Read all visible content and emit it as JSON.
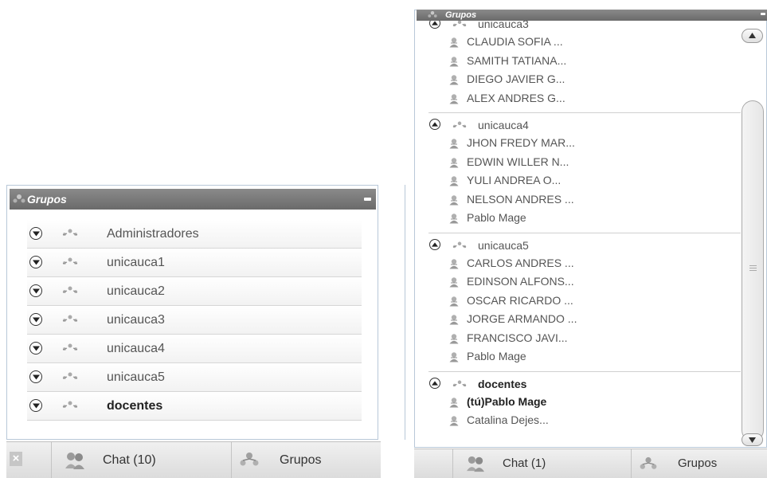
{
  "left_panel": {
    "title": "Grupos",
    "groups": [
      {
        "name": "Administradores",
        "bold": false
      },
      {
        "name": "unicauca1",
        "bold": false
      },
      {
        "name": "unicauca2",
        "bold": false
      },
      {
        "name": "unicauca3",
        "bold": false
      },
      {
        "name": "unicauca4",
        "bold": false
      },
      {
        "name": "unicauca5",
        "bold": false
      },
      {
        "name": "docentes",
        "bold": true
      }
    ],
    "tabs": {
      "chat_label": "Chat (10)",
      "groups_label": "Grupos"
    },
    "close_label": "×"
  },
  "right_panel": {
    "title": "Grupos",
    "groups": [
      {
        "name": "unicauca3",
        "bold": false,
        "members": [
          {
            "name": "CLAUDIA SOFIA ...",
            "bold": false
          },
          {
            "name": "SAMITH TATIANA...",
            "bold": false
          },
          {
            "name": "DIEGO JAVIER G...",
            "bold": false
          },
          {
            "name": "ALEX ANDRES G...",
            "bold": false
          }
        ]
      },
      {
        "name": "unicauca4",
        "bold": false,
        "members": [
          {
            "name": "JHON FREDY MAR...",
            "bold": false
          },
          {
            "name": "EDWIN WILLER N...",
            "bold": false
          },
          {
            "name": "YULI ANDREA O...",
            "bold": false
          },
          {
            "name": "NELSON ANDRES ...",
            "bold": false
          },
          {
            "name": "Pablo Mage",
            "bold": false
          }
        ]
      },
      {
        "name": "unicauca5",
        "bold": false,
        "members": [
          {
            "name": "CARLOS ANDRES ...",
            "bold": false
          },
          {
            "name": "EDINSON ALFONS...",
            "bold": false
          },
          {
            "name": "OSCAR RICARDO ...",
            "bold": false
          },
          {
            "name": "JORGE ARMANDO ...",
            "bold": false
          },
          {
            "name": "FRANCISCO JAVI...",
            "bold": false
          },
          {
            "name": "Pablo Mage",
            "bold": false
          }
        ]
      },
      {
        "name": "docentes",
        "bold": true,
        "members": [
          {
            "name": "(tú)Pablo Mage",
            "bold": true
          },
          {
            "name": "Catalina Dejes...",
            "bold": false
          }
        ]
      }
    ],
    "tabs": {
      "chat_label": "Chat (1)",
      "groups_label": "Grupos"
    }
  },
  "colors": {
    "titlebar": "#7a7a7a",
    "border": "#b8c8d8",
    "tab_bg": "#e6e6e6"
  }
}
